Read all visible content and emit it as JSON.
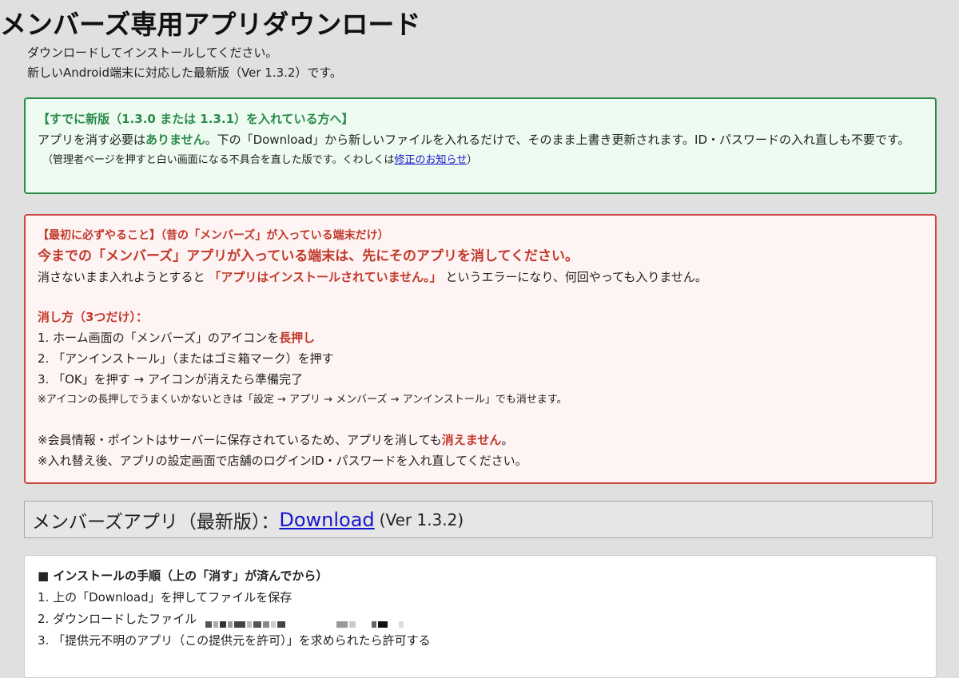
{
  "page": {
    "title": "メンバーズ専用アプリダウンロード",
    "intro_line1": "ダウンロードしてインストールしてください。",
    "intro_line2": "新しいAndroid端末に対応した最新版（Ver 1.3.2）です。"
  },
  "green_box": {
    "heading": "【すでに新版（1.3.0 または 1.3.1）を入れている方へ】",
    "line1_pre": "アプリを消す必要は",
    "line1_strong": "ありません",
    "line1_post": "。下の「Download」から新しいファイルを入れるだけで、そのまま上書き更新されます。ID・パスワードの入れ直しも不要です。",
    "note_pre": "（管理者ページを押すと白い画面になる不具合を直した版です。くわしくは",
    "note_link": "修正のお知らせ",
    "note_post": "）"
  },
  "red_box": {
    "heading": "【最初に必ずやること】（昔の「メンバーズ」が入っている端末だけ）",
    "headline": "今までの「メンバーズ」アプリが入っている端末は、先にそのアプリを消してください。",
    "error_pre": "消さないまま入れようとすると",
    "error_strong": "「アプリはインストールされていません。」",
    "error_post": "というエラーになり、何回やっても入りません。",
    "how_heading": "消し方（3つだけ）：",
    "step1_pre": "1. ホーム画面の「メンバーズ」のアイコンを",
    "step1_strong": "長押し",
    "step2": "2. 「アンインストール」（またはゴミ箱マーク）を押す",
    "step3": "3. 「OK」を押す → アイコンが消えたら準備完了",
    "tip": "※アイコンの長押しでうまくいかないときは「設定 → アプリ → メンバーズ → アンインストール」でも消せます。",
    "note1_pre": "※会員情報・ポイントはサーバーに保存されているため、アプリを消しても",
    "note1_strong": "消えません",
    "note1_post": "。",
    "note2": "※入れ替え後、アプリの設定画面で店舗のログインID・パスワードを入れ直してください。"
  },
  "download_bar": {
    "label": "メンバーズアプリ（最新版）：",
    "link": "Download",
    "version": "(Ver 1.3.2)"
  },
  "install_steps": {
    "heading": "■ インストールの手順（上の「消す」が済んでから）",
    "step1": "1. 上の「Download」を押してファイルを保存",
    "step2": "2. ダウンロードしたファイル",
    "step3": "3. 「提供元不明のアプリ（この提供元を許可）」を求められたら許可する"
  }
}
